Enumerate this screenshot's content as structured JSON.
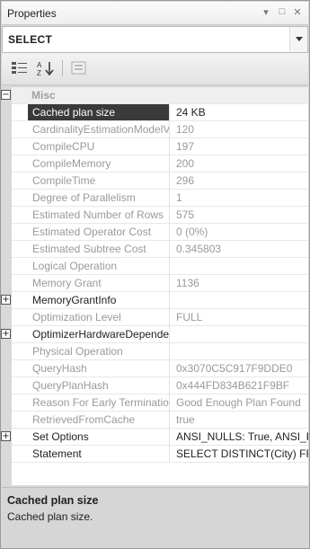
{
  "window": {
    "title": "Properties",
    "controls": [
      "▾",
      "□",
      "✕"
    ]
  },
  "object_selector": {
    "value": "SELECT"
  },
  "toolbar": {
    "buttons": [
      "categorized-icon",
      "sort-alpha-icon",
      "property-pages-icon"
    ]
  },
  "grid": {
    "category": "Misc",
    "rows": [
      {
        "name": "Cached plan size",
        "value": "24 KB"
      },
      {
        "name": "CardinalityEstimationModelV",
        "value": "120"
      },
      {
        "name": "CompileCPU",
        "value": "197"
      },
      {
        "name": "CompileMemory",
        "value": "200"
      },
      {
        "name": "CompileTime",
        "value": "296"
      },
      {
        "name": "Degree of Parallelism",
        "value": "1"
      },
      {
        "name": "Estimated Number of Rows",
        "value": "575"
      },
      {
        "name": "Estimated Operator Cost",
        "value": "0 (0%)"
      },
      {
        "name": "Estimated Subtree Cost",
        "value": "0.345803"
      },
      {
        "name": "Logical Operation",
        "value": ""
      },
      {
        "name": "Memory Grant",
        "value": "1136"
      },
      {
        "name": "MemoryGrantInfo",
        "value": ""
      },
      {
        "name": "Optimization Level",
        "value": "FULL"
      },
      {
        "name": "OptimizerHardwareDepende",
        "value": ""
      },
      {
        "name": "Physical Operation",
        "value": ""
      },
      {
        "name": "QueryHash",
        "value": "0x3070C5C917F9DDE0"
      },
      {
        "name": "QueryPlanHash",
        "value": "0x444FD834B621F9BF"
      },
      {
        "name": "Reason For Early Terminatio",
        "value": "Good Enough Plan Found"
      },
      {
        "name": "RetrievedFromCache",
        "value": "true"
      },
      {
        "name": "Set Options",
        "value": "ANSI_NULLS: True, ANSI_P"
      },
      {
        "name": "Statement",
        "value": "SELECT DISTINCT(City) FR"
      }
    ]
  },
  "description": {
    "title": "Cached plan size",
    "text": "Cached plan size."
  }
}
